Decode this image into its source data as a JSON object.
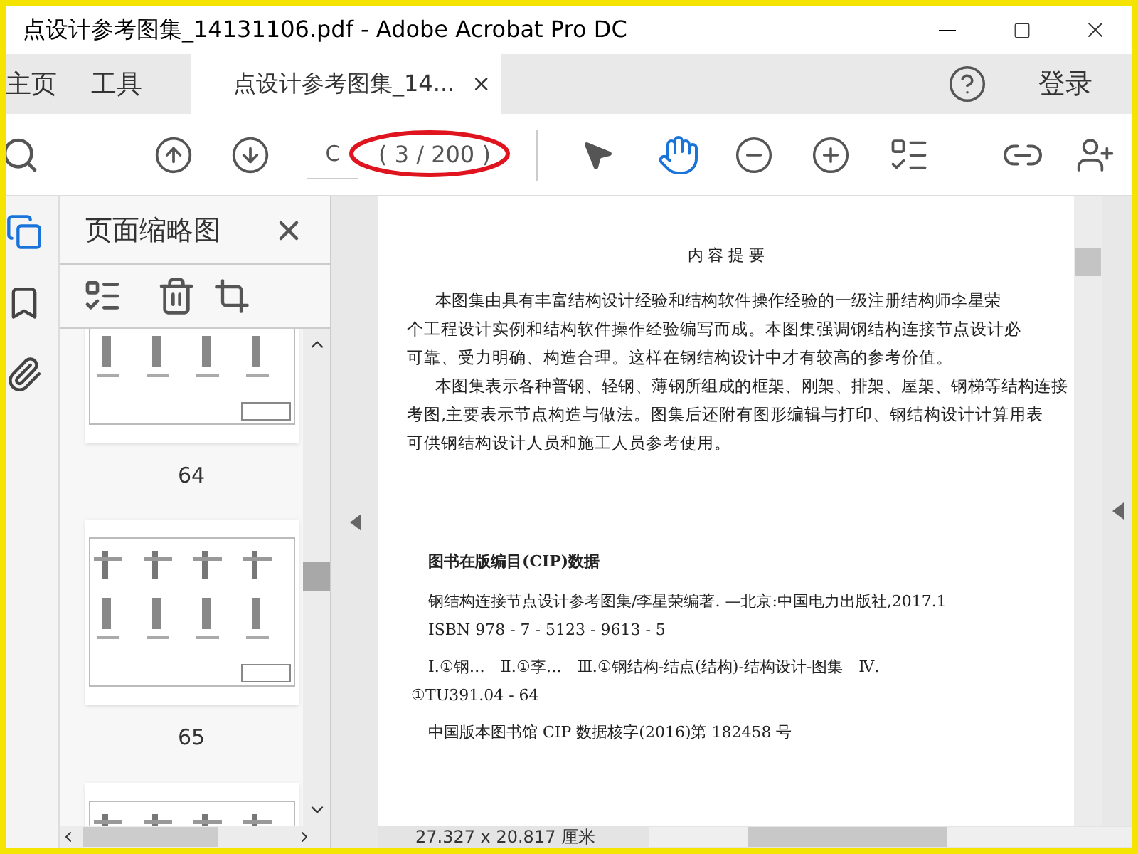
{
  "window": {
    "title": "点设计参考图集_14131106.pdf - Adobe Acrobat Pro DC"
  },
  "nav_tabs": [
    {
      "label": "主页",
      "selected": false
    },
    {
      "label": "工具",
      "selected": false
    }
  ],
  "doc_tab": {
    "label": "点设计参考图集_14...",
    "close": "×",
    "selected": true
  },
  "sign_in": "登录",
  "toolbar": {
    "page_field": "C",
    "page_count": "( 3 / 200 )"
  },
  "thumbnails": {
    "title": "页面缩略图",
    "pages": [
      {
        "label": "64",
        "selected": false
      },
      {
        "label": "65",
        "selected": false
      },
      {
        "selected": false
      }
    ]
  },
  "page": {
    "heading": "内 容 提 要",
    "abstract_lines": [
      "本图集由具有丰富结构设计经验和结构软件操作经验的一级注册结构师李星荣",
      "个工程设计实例和结构软件操作经验编写而成。本图集强调钢结构连接节点设计必",
      "可靠、受力明确、构造合理。这样在钢结构设计中才有较高的参考价值。",
      "本图集表示各种普钢、轻钢、薄钢所组成的框架、刚架、排架、屋架、钢梯等结构连接",
      "考图,主要表示节点构造与做法。图集后还附有图形编辑与打印、钢结构设计计算用表",
      "可供钢结构设计人员和施工人员参考使用。"
    ],
    "cip_title": "图书在版编目(CIP)数据",
    "cip_lines": [
      "钢结构连接节点设计参考图集/李星荣编著. —北京:中国电力出版社,2017.1",
      "ISBN 978 - 7 - 5123 - 9613 - 5",
      "Ⅰ.①钢…　Ⅱ.①李…　Ⅲ.①钢结构-结点(结构)-结构设计-图集　Ⅳ.",
      "①TU391.04 - 64",
      "中国版本图书馆 CIP 数据核字(2016)第 182458 号"
    ]
  },
  "status_bar": {
    "page_size": "27.327 x 20.817 厘米"
  }
}
